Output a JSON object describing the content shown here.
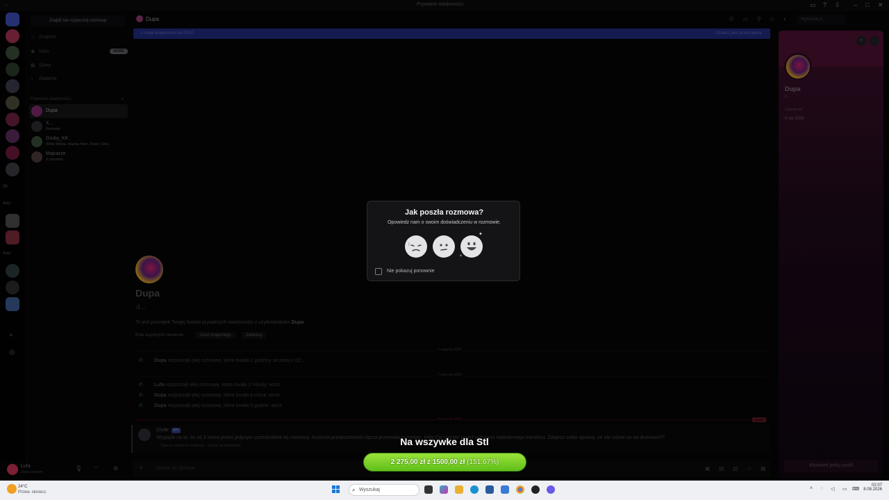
{
  "window": {
    "title": "Prywatne wiadomości"
  },
  "rail": {
    "label_1": "Sulyt",
    "label_2": "Sulyt",
    "count": "06"
  },
  "sidebar": {
    "search_placeholder": "Znajdź lub rozpocznij rozmowę",
    "nav": [
      {
        "label": "Znajomi",
        "icon": "friends-icon"
      },
      {
        "label": "Nitro",
        "icon": "nitro-icon",
        "badge": "NOWE"
      },
      {
        "label": "Sklep",
        "icon": "shop-icon"
      },
      {
        "label": "Zadania",
        "icon": "quests-icon"
      }
    ],
    "section_title": "Prywatne wiadomości",
    "dms": [
      {
        "name": "Dupa",
        "sub": ""
      },
      {
        "name": "X...",
        "sub": "Nocimalo"
      },
      {
        "name": "Gruby_KK",
        "sub": "White Widow, Mazzai, Baro, Rosie, Chlo..."
      },
      {
        "name": "Majcarze",
        "sub": "9 członków"
      }
    ]
  },
  "user": {
    "name": "Lufa",
    "status": "Zaraz wracam"
  },
  "chat": {
    "channel_name": "Dupa",
    "search_placeholder": "Wyszukaj d...",
    "new_messages": "1 nowa wiadomości od 00:47",
    "mark_read": "Oznacz jako przeczytane",
    "welcome_name": "Dupa",
    "welcome_sub": "d...",
    "welcome_text_pre": "To jest początek Twojej historii prywatnych wiadomości z użytkownikiem ",
    "welcome_text_user": "Dupa",
    "no_servers": "Brak wspólnych serwerów",
    "remove_friend": "Usuń znajomego",
    "block": "Zablokuj",
    "date_1": "6 sierpnia 2026",
    "date_2": "7 sierpnia 2026",
    "date_3": "8 sierpnia 2026",
    "calls": [
      {
        "user": "Dupa",
        "text": "rozpoczął(-ęła) rozmowę, która trwała 2 godziny. wczoraj o 02:..."
      },
      {
        "user": "Lufa",
        "text": "rozpoczął(-ęła) rozmowę, która trwała 2 minuty. wczo"
      },
      {
        "user": "Dupa",
        "text": "rozpoczął(-ęła) rozmowę, która trwała a minut. wcze"
      },
      {
        "user": "Dupa",
        "text": "rozpoczął(-ęła) rozmowę, która trwała 5 godzin. wcze"
      }
    ],
    "new_badge": "NOWE",
    "system_message": {
      "author": "Clyde",
      "bot_tag": "APL",
      "text": "Wygląda na to, że od 3 minut jesteś jedynym uczestnikiem tej rozmowy. Kontrola przepustowości łącza przerwała rozmowę, żeby Cię ustrzec przed zużyciem nadmiernego transferu. Zdajesz sobie sprawę, że nie rośnie on na drzewach?!",
      "note": "Tylko ty możesz to zobaczyć · Odrzuć tę wiadomość"
    },
    "composer_placeholder": "Napisz do @Dupa"
  },
  "profile": {
    "name": "Dupa",
    "sub": "d...",
    "member_since_label": "Członek od",
    "member_since": "6 sie 2026",
    "view_full": "Wyświetl pełny profil"
  },
  "modal": {
    "title": "Jak poszła rozmowa?",
    "description": "Opowiedz nam o swoim doświadczeniu w rozmowie.",
    "dont_show": "Nie pokazuj ponownie"
  },
  "stream_goal": {
    "title": "Na wszywke dla Stl",
    "current": "2 275,00 zł",
    "separator": "z",
    "target": "1500,00 zł",
    "percent": "(151.67%)"
  },
  "taskbar": {
    "temperature": "24°C",
    "weather": "Przew. słonecz.",
    "search_placeholder": "Wyszukaj",
    "time": "02:07",
    "date": "8.08.2026"
  },
  "colors": {
    "accent": "#1f2a7a",
    "goal_green": "#5fbf1a",
    "modal_bg": "#141416"
  }
}
